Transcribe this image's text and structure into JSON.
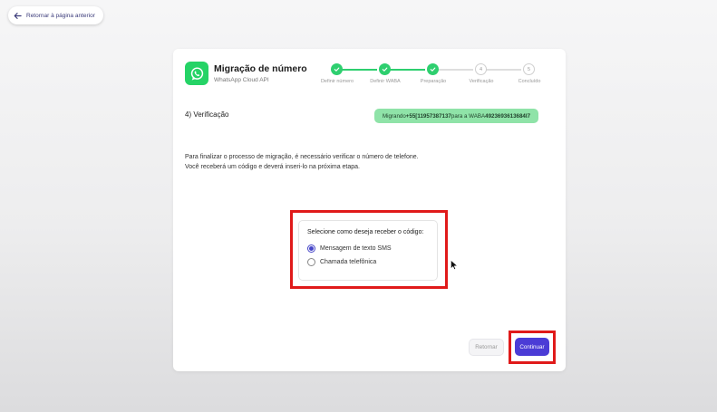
{
  "back_link": {
    "label": "Retornar à página anterior",
    "icon": "arrow-left-icon"
  },
  "header": {
    "logo_icon": "whatsapp-icon",
    "title": "Migração de número",
    "subtitle": "WhatsApp Cloud API"
  },
  "steps": [
    {
      "number": "1",
      "label": "Definir número",
      "status": "done"
    },
    {
      "number": "2",
      "label": "Definir WABA",
      "status": "done"
    },
    {
      "number": "3",
      "label": "Preparação",
      "status": "done"
    },
    {
      "number": "4",
      "label": "Verificação",
      "status": "current"
    },
    {
      "number": "5",
      "label": "Concluído",
      "status": "pending"
    }
  ],
  "section_title": "4) Verificação",
  "migration_badge": {
    "prefix": "Migrando ",
    "number": "+55[11957387137",
    "middle": " para a WABA ",
    "waba_id": "4923693613684I7"
  },
  "description": {
    "line1": "Para finalizar o processo de migração, é necessário verificar o número de telefone.",
    "line2": "Você receberá um código e deverá inseri-lo na próxima etapa."
  },
  "verification_choice": {
    "title": "Selecione como deseja receber o código:",
    "options": [
      {
        "label": "Mensagem de texto SMS",
        "selected": true
      },
      {
        "label": "Chamada telefônica",
        "selected": false
      }
    ]
  },
  "actions": {
    "back_label": "Retornar",
    "continue_label": "Continuar"
  },
  "colors": {
    "accent": "#4b3cd6",
    "success": "#2ecf6f",
    "badge_bg": "#8fe3a8",
    "highlight": "#e01a1a",
    "whatsapp": "#25d366"
  }
}
